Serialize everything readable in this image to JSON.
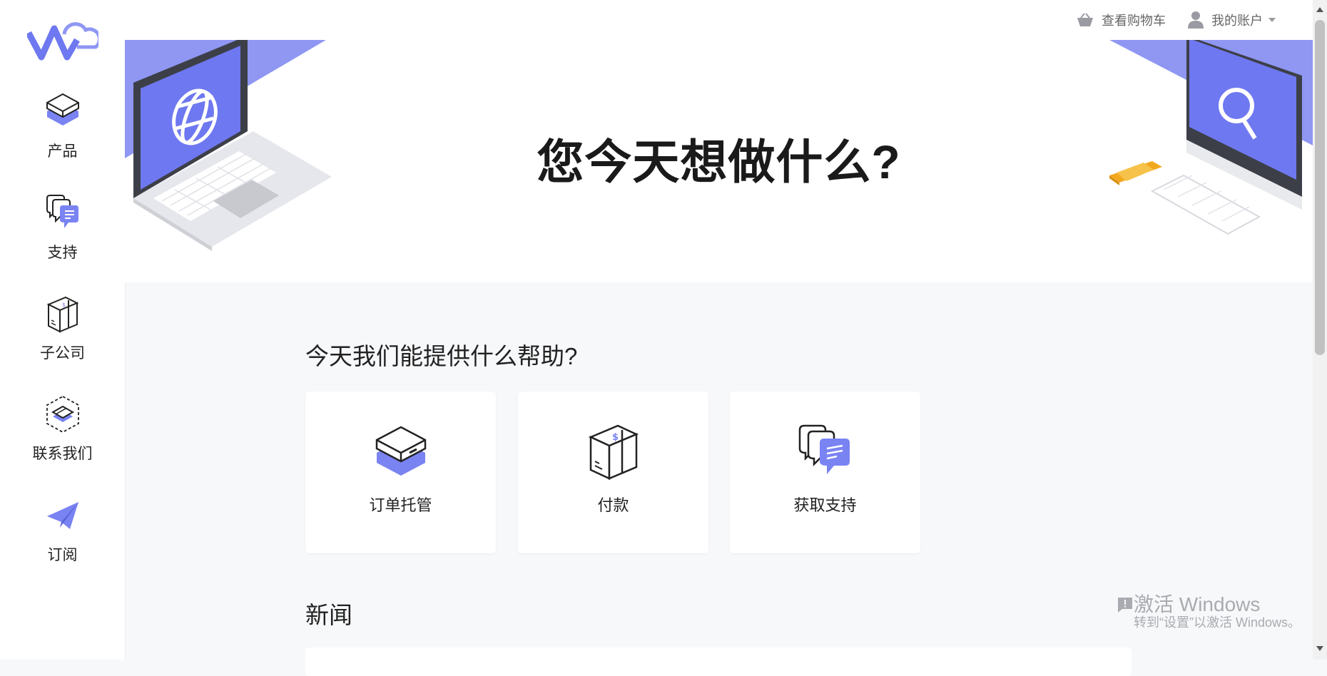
{
  "colors": {
    "accent": "#6e78f0",
    "accent_light": "#9199f6",
    "hero_shape": "#8f97f3"
  },
  "sidebar": {
    "logo_icon": "logo-icon",
    "items": [
      {
        "label": "产品",
        "icon": "server-icon"
      },
      {
        "label": "支持",
        "icon": "chat-bubbles-icon"
      },
      {
        "label": "子公司",
        "icon": "package-icon"
      },
      {
        "label": "联系我们",
        "icon": "layers-icon"
      },
      {
        "label": "订阅",
        "icon": "paper-plane-icon"
      }
    ]
  },
  "header": {
    "cart_label": "查看购物车",
    "cart_icon": "basket-icon",
    "account_label": "我的账户",
    "account_icon": "user-icon"
  },
  "hero": {
    "title": "您今天想做什么?",
    "left_illustration": "laptop-globe-illustration",
    "right_illustration": "desktop-search-illustration"
  },
  "main": {
    "help_heading": "今天我们能提供什么帮助?",
    "cards": [
      {
        "label": "订单托管",
        "icon": "server-icon"
      },
      {
        "label": "付款",
        "icon": "package-icon"
      },
      {
        "label": "获取支持",
        "icon": "chat-bubbles-icon"
      }
    ],
    "news_heading": "新闻"
  },
  "watermark": {
    "title": "激活 Windows",
    "subtitle": "转到“设置”以激活 Windows。"
  }
}
